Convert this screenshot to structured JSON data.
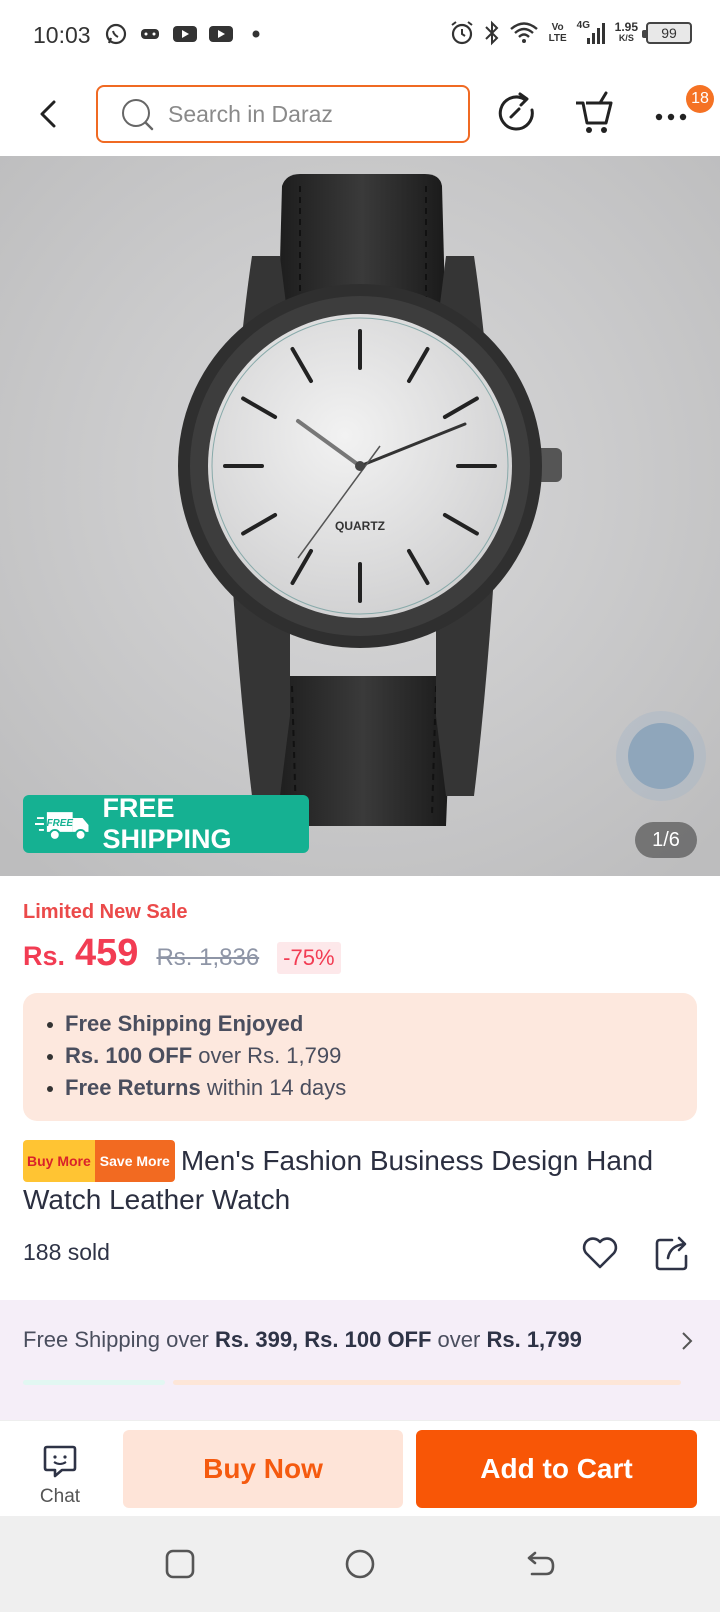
{
  "status_bar": {
    "time": "10:03",
    "network_volte": "Vo LTE",
    "network_4g": "4G",
    "speed_value": "1.95",
    "speed_unit": "K/S",
    "battery": "99",
    "icons": [
      "whatsapp-icon",
      "game-icon",
      "youtube-icon",
      "youtube-icon",
      "dot-icon",
      "alarm-icon",
      "bluetooth-icon",
      "wifi-icon",
      "signal-icon",
      "battery-icon"
    ]
  },
  "top_nav": {
    "search_placeholder": "Search in Daraz",
    "cart_badge": "18",
    "icons": [
      "back-arrow-icon",
      "search-icon",
      "share-refresh-icon",
      "cart-icon",
      "more-icon"
    ]
  },
  "gallery": {
    "free_shipping_label": "FREE SHIPPING",
    "free_truck_text": "FREE",
    "dial_text": "QUARTZ",
    "counter": "1/6"
  },
  "product": {
    "sale_label": "Limited New Sale",
    "currency": "Rs.",
    "price": "459",
    "original_price": "Rs. 1,836",
    "discount": "-75%",
    "benefits": [
      {
        "bold": "Free Shipping Enjoyed",
        "rest": ""
      },
      {
        "bold": "Rs. 100 OFF",
        "rest": " over Rs. 1,799"
      },
      {
        "bold": "Free Returns",
        "rest": " within 14 days"
      }
    ],
    "tag_buy_more": "Buy More",
    "tag_save_more": "Save More",
    "title": "Men's Fashion Business Design Hand Watch Leather Watch",
    "sold": "188 sold"
  },
  "promo": {
    "prefix": "Free Shipping over ",
    "bold1": "Rs. 399, Rs. 100 OFF",
    "middle": " over ",
    "bold2": "Rs. 1,799"
  },
  "actions": {
    "chat_label": "Chat",
    "buy_now": "Buy Now",
    "add_to_cart": "Add to Cart"
  },
  "colors": {
    "accent": "#f85606",
    "price": "#f23c53",
    "free_shipping": "#15b192"
  }
}
